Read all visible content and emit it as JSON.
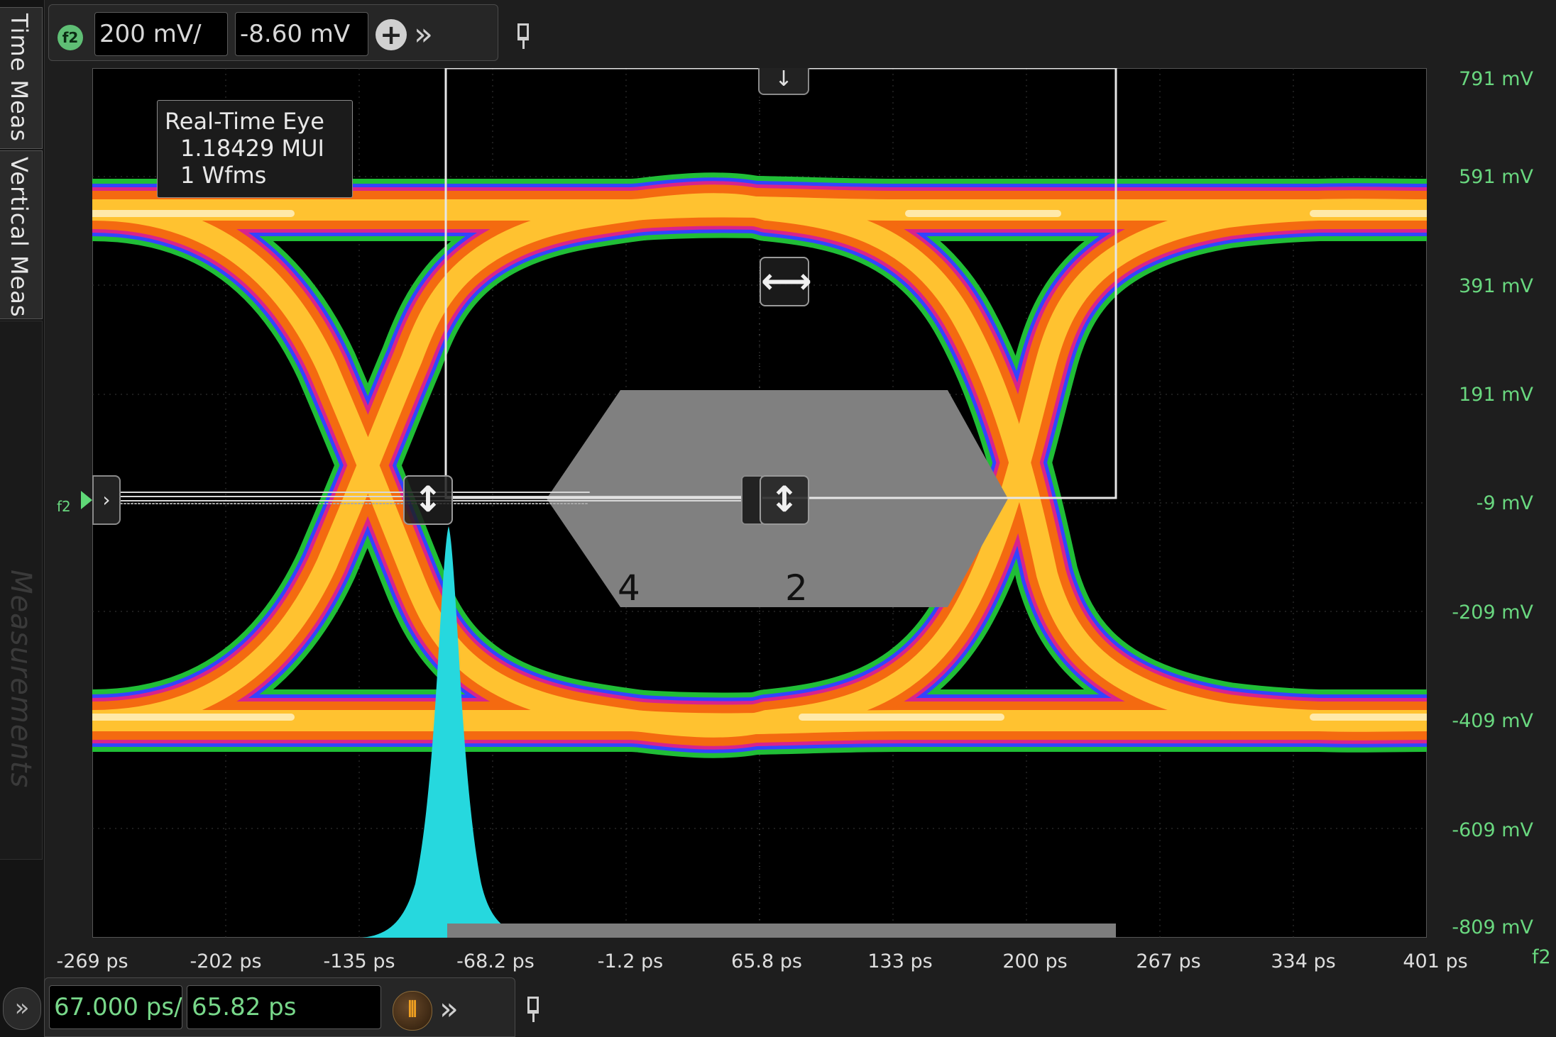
{
  "sidebar": {
    "tabs": [
      {
        "label": "Time Meas"
      },
      {
        "label": "Vertical Meas"
      },
      {
        "label": "Measurements"
      }
    ]
  },
  "top_toolbar": {
    "channel_badge": "f2",
    "vertical_scale": "200 mV/",
    "vertical_offset": "-8.60 mV",
    "add_icon": "plus-icon",
    "more_icon": "double-chevron-right-icon",
    "pin_icon": "pin-icon"
  },
  "info_box": {
    "title": "Real-Time Eye",
    "line1": "1.18429 MUI",
    "line2": "1 Wfms"
  },
  "y_axis": {
    "labels": [
      "791 mV",
      "591 mV",
      "391 mV",
      "191 mV",
      "-9 mV",
      "-209 mV",
      "-409 mV",
      "-609 mV",
      "-809 mV"
    ]
  },
  "x_axis": {
    "labels": [
      "-269 ps",
      "-202 ps",
      "-135 ps",
      "-68.2 ps",
      "-1.2 ps",
      "65.8 ps",
      "133 ps",
      "200 ps",
      "267 ps",
      "334 ps",
      "401 ps"
    ],
    "channel": "f2"
  },
  "markers": {
    "ref_channel": "f2"
  },
  "mask": {
    "region_labels": [
      "4",
      "2"
    ]
  },
  "bottom_toolbar": {
    "time_scale": "67.000 ps/",
    "time_position": "65.82 ps",
    "horizontal_icon": "vertical-bars-icon",
    "more_icon": "double-chevron-right-icon",
    "pin_icon": "pin-icon"
  },
  "colors": {
    "accent_green": "#69d77f",
    "histogram": "#26d8de",
    "mask": "#808080"
  }
}
